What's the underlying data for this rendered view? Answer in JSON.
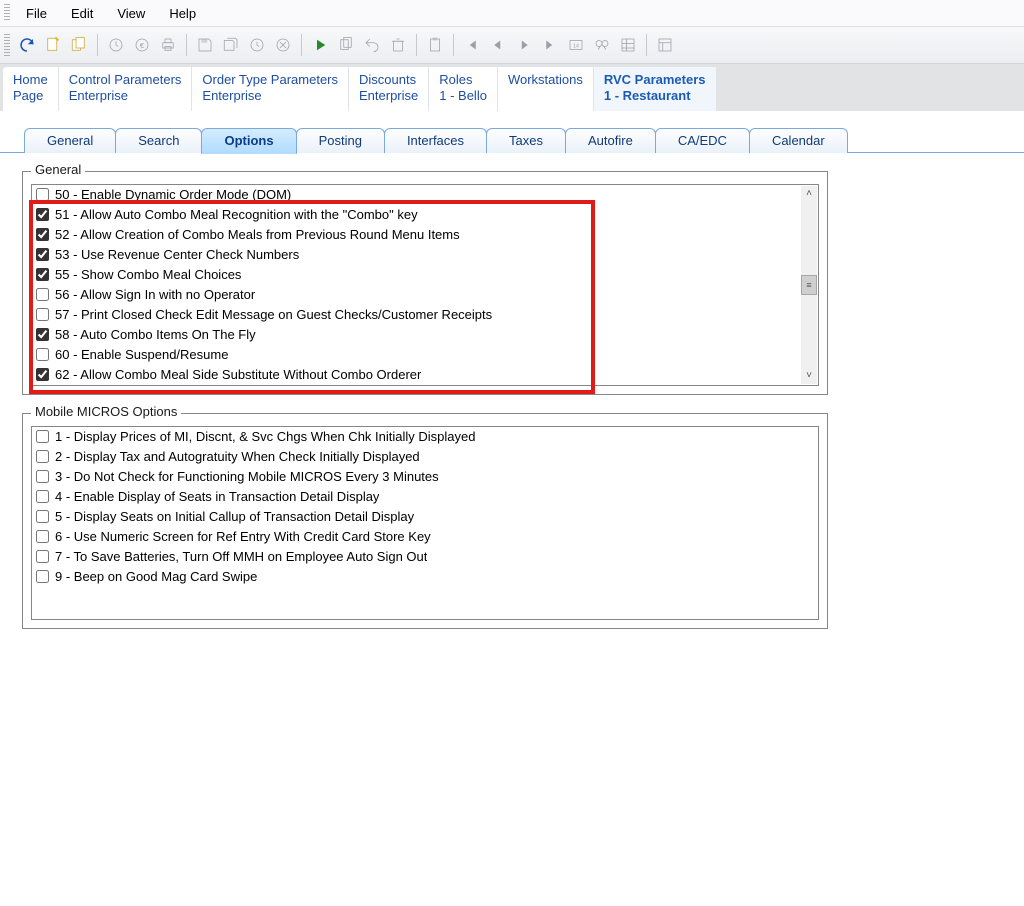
{
  "menu": {
    "items": [
      "File",
      "Edit",
      "View",
      "Help"
    ]
  },
  "nav": [
    {
      "line1": "Home",
      "line2": "Page"
    },
    {
      "line1": "Control Parameters",
      "line2": "Enterprise"
    },
    {
      "line1": "Order Type Parameters",
      "line2": "Enterprise"
    },
    {
      "line1": "Discounts",
      "line2": "Enterprise"
    },
    {
      "line1": "Roles",
      "line2": "1 - Bello"
    },
    {
      "line1": "Workstations",
      "line2": ""
    },
    {
      "line1": "RVC Parameters",
      "line2": "1 - Restaurant",
      "active": true
    }
  ],
  "subtabs": [
    "General",
    "Search",
    "Options",
    "Posting",
    "Interfaces",
    "Taxes",
    "Autofire",
    "CA/EDC",
    "Calendar"
  ],
  "subtab_active": 2,
  "general_group": {
    "legend": "General",
    "items": [
      {
        "checked": false,
        "label": "50 - Enable Dynamic Order Mode (DOM)"
      },
      {
        "checked": true,
        "label": "51 - Allow Auto Combo Meal Recognition with the \"Combo\" key"
      },
      {
        "checked": true,
        "label": "52 - Allow Creation of Combo Meals from Previous Round Menu Items"
      },
      {
        "checked": true,
        "label": "53 - Use Revenue Center Check Numbers"
      },
      {
        "checked": true,
        "label": "55 - Show Combo Meal Choices"
      },
      {
        "checked": false,
        "label": "56 - Allow Sign In with no Operator"
      },
      {
        "checked": false,
        "label": "57 - Print Closed Check Edit Message on Guest Checks/Customer Receipts"
      },
      {
        "checked": true,
        "label": "58 - Auto Combo Items On The Fly"
      },
      {
        "checked": false,
        "label": "60 - Enable Suspend/Resume"
      },
      {
        "checked": true,
        "label": "62 - Allow Combo Meal Side Substitute Without Combo Orderer"
      }
    ]
  },
  "mobile_group": {
    "legend": "Mobile MICROS Options",
    "items": [
      {
        "checked": false,
        "label": "1 - Display Prices of MI, Discnt, & Svc Chgs When Chk Initially Displayed"
      },
      {
        "checked": false,
        "label": "2 - Display Tax and Autogratuity When Check Initially Displayed"
      },
      {
        "checked": false,
        "label": "3 - Do Not Check for Functioning Mobile MICROS Every 3 Minutes"
      },
      {
        "checked": false,
        "label": "4 - Enable Display of Seats in Transaction Detail Display"
      },
      {
        "checked": false,
        "label": "5 - Display Seats on Initial Callup of Transaction Detail Display"
      },
      {
        "checked": false,
        "label": "6 - Use Numeric Screen for Ref Entry With Credit Card Store Key"
      },
      {
        "checked": false,
        "label": "7 - To Save Batteries, Turn Off MMH on Employee Auto Sign Out"
      },
      {
        "checked": false,
        "label": "9 - Beep on Good Mag Card Swipe"
      }
    ]
  }
}
